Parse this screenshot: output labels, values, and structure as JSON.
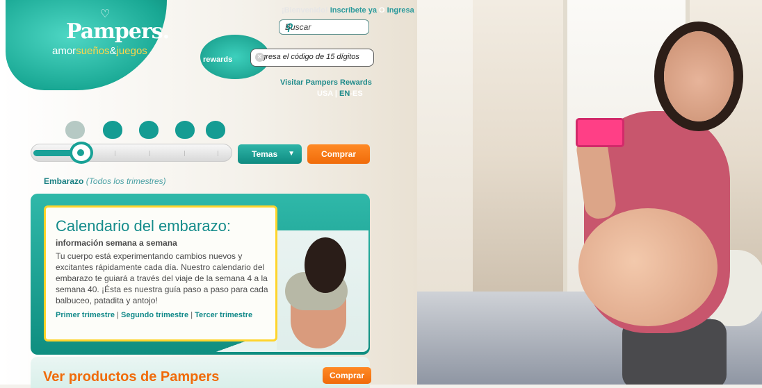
{
  "brand": {
    "logo_text": "Pampers.",
    "tagline_parts": [
      "amor",
      "sueños",
      "&",
      "juegos"
    ]
  },
  "header": {
    "welcome": "¡Bienvenido!",
    "signup_link": "Inscríbete ya",
    "or": "O",
    "login_link": "Ingresa",
    "search_placeholder": "Buscar",
    "rewards_logo_text": "rewards",
    "code_placeholder": "Ingresa el código de 15 dígitos",
    "visit_rewards": "Visitar Pampers Rewards",
    "lang_usa": "USA",
    "lang_sep": "|",
    "lang_en": "EN",
    "lang_dash": "-",
    "lang_es": "ES"
  },
  "nav": {
    "stages": [
      "pregnancy-icon",
      "newborn-icon",
      "baby-icon",
      "toddler-icon",
      "preschooler-icon"
    ],
    "slider_level_index": 0,
    "temas_label": "Temas",
    "comprar_label": "Comprar"
  },
  "breadcrumb": {
    "section": "Embarazo",
    "detail": "(Todos los trimestres)"
  },
  "feature": {
    "title": "Calendario del embarazo:",
    "subtitle": "información semana a semana",
    "body": "Tu cuerpo está experimentando cambios nuevos y excitantes rápidamente cada día. Nuestro calendario del embarazo te guiará a través del viaje de la semana 4 a la semana 40. ¡Ésta es nuestra guía paso a paso para cada balbuceo, patadita y antojo!",
    "links": [
      "Primer trimestre",
      "Segundo trimestre",
      "Tercer trimestre"
    ],
    "link_sep": "|"
  },
  "products": {
    "title": "Ver productos de Pampers",
    "comprar_label": "Comprar"
  },
  "colors": {
    "teal": "#149c93",
    "orange": "#f06b0a",
    "yellow_border": "#ffd42b"
  }
}
